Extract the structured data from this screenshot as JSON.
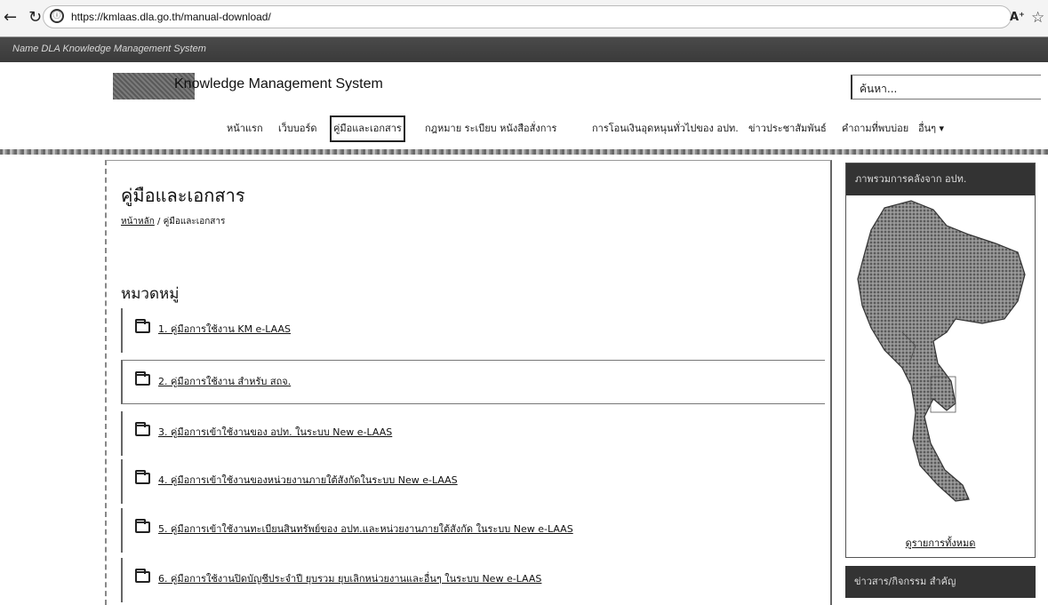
{
  "browser": {
    "url": "https://kmlaas.dla.go.th/manual-download/",
    "read_aloud": "A⁺"
  },
  "site": {
    "strip_text": "Name DLA Knowledge Management System",
    "brand": "Knowledge Management System",
    "search_placeholder": "ค้นหา...",
    "menu": [
      {
        "label": "หน้าแรก"
      },
      {
        "label": "เว็บบอร์ด"
      },
      {
        "label": "คู่มือและเอกสาร"
      },
      {
        "label": "กฎหมาย ระเบียบ หนังสือสั่งการ"
      },
      {
        "label": "การโอนเงินอุดหนุนทั่วไปของ อปท."
      },
      {
        "label": "ข่าวประชาสัมพันธ์"
      },
      {
        "label": "คำถามที่พบบ่อย"
      },
      {
        "label": "อื่นๆ ▾"
      }
    ]
  },
  "main": {
    "title": "คู่มือและเอกสาร",
    "breadcrumb_home": "หน้าหลัก",
    "breadcrumb_sep": " / ",
    "breadcrumb_current": "คู่มือและเอกสาร",
    "section_title": "หมวดหมู่",
    "categories": [
      {
        "label": "1. คู่มือการใช้งาน KM e-LAAS"
      },
      {
        "label": "2. คู่มือการใช้งาน สำหรับ สถจ."
      },
      {
        "label": "3. คู่มือการเข้าใช้งานของ อปท. ในระบบ New e-LAAS"
      },
      {
        "label": "4. คู่มือการเข้าใช้งานของหน่วยงานภายใต้สังกัดในระบบ New e-LAAS"
      },
      {
        "label": "5. คู่มือการเข้าใช้งานทะเบียนสินทรัพย์ของ อปท.และหน่วยงานภายใต้สังกัด ในระบบ New e-LAAS"
      },
      {
        "label": "6. คู่มือการใช้งานปิดบัญชีประจำปี ยุบรวม ยุบเลิกหน่วยงานและอื่นๆ ในระบบ New e-LAAS"
      }
    ]
  },
  "sidebar": {
    "box1_title": "ภาพรวมการคลังจาก อปท.",
    "box1_link": "ดูรายการทั้งหมด",
    "box2_title": "ข่าวสาร/กิจกรรม สำคัญ"
  }
}
